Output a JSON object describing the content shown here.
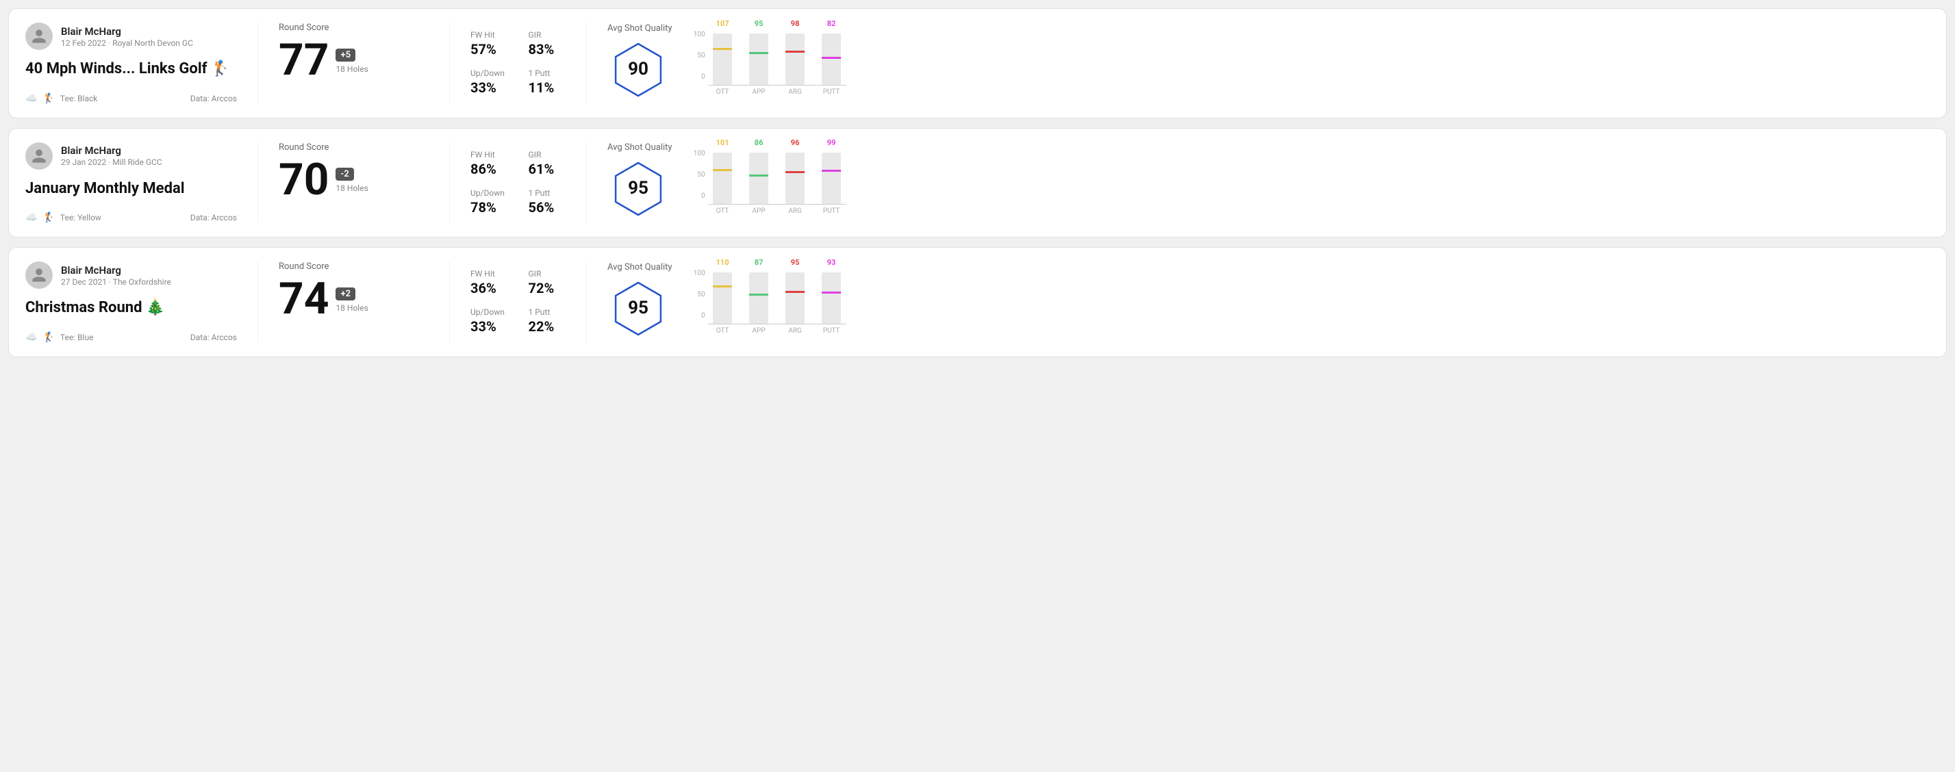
{
  "rounds": [
    {
      "id": "round-1",
      "user": {
        "name": "Blair McHarg",
        "date": "12 Feb 2022 · Royal North Devon GC"
      },
      "title": "40 Mph Winds... Links Golf 🏌️",
      "tee": "Black",
      "data_source": "Data: Arccos",
      "score": {
        "value": "77",
        "diff": "+5",
        "holes": "18 Holes"
      },
      "stats": {
        "fw_hit": "57%",
        "gir": "83%",
        "up_down": "33%",
        "one_putt": "11%"
      },
      "avg_quality": "90",
      "chart": {
        "bars": [
          {
            "label": "OTT",
            "value": 107,
            "color": "#e8c040",
            "height_pct": 72
          },
          {
            "label": "APP",
            "value": 95,
            "color": "#50c878",
            "height_pct": 64
          },
          {
            "label": "ARG",
            "value": 98,
            "color": "#e04040",
            "height_pct": 66
          },
          {
            "label": "PUTT",
            "value": 82,
            "color": "#e040e0",
            "height_pct": 55
          }
        ]
      }
    },
    {
      "id": "round-2",
      "user": {
        "name": "Blair McHarg",
        "date": "29 Jan 2022 · Mill Ride GCC"
      },
      "title": "January Monthly Medal",
      "tee": "Yellow",
      "data_source": "Data: Arccos",
      "score": {
        "value": "70",
        "diff": "-2",
        "holes": "18 Holes"
      },
      "stats": {
        "fw_hit": "86%",
        "gir": "61%",
        "up_down": "78%",
        "one_putt": "56%"
      },
      "avg_quality": "95",
      "chart": {
        "bars": [
          {
            "label": "OTT",
            "value": 101,
            "color": "#e8c040",
            "height_pct": 68
          },
          {
            "label": "APP",
            "value": 86,
            "color": "#50c878",
            "height_pct": 58
          },
          {
            "label": "ARG",
            "value": 96,
            "color": "#e04040",
            "height_pct": 65
          },
          {
            "label": "PUTT",
            "value": 99,
            "color": "#e040e0",
            "height_pct": 67
          }
        ]
      }
    },
    {
      "id": "round-3",
      "user": {
        "name": "Blair McHarg",
        "date": "27 Dec 2021 · The Oxfordshire"
      },
      "title": "Christmas Round 🎄",
      "tee": "Blue",
      "data_source": "Data: Arccos",
      "score": {
        "value": "74",
        "diff": "+2",
        "holes": "18 Holes"
      },
      "stats": {
        "fw_hit": "36%",
        "gir": "72%",
        "up_down": "33%",
        "one_putt": "22%"
      },
      "avg_quality": "95",
      "chart": {
        "bars": [
          {
            "label": "OTT",
            "value": 110,
            "color": "#e8c040",
            "height_pct": 74
          },
          {
            "label": "APP",
            "value": 87,
            "color": "#50c878",
            "height_pct": 59
          },
          {
            "label": "ARG",
            "value": 95,
            "color": "#e04040",
            "height_pct": 64
          },
          {
            "label": "PUTT",
            "value": 93,
            "color": "#e040e0",
            "height_pct": 63
          }
        ]
      }
    }
  ],
  "labels": {
    "round_score": "Round Score",
    "fw_hit": "FW Hit",
    "gir": "GIR",
    "up_down": "Up/Down",
    "one_putt": "1 Putt",
    "avg_quality": "Avg Shot Quality",
    "data_arccos": "Data: Arccos",
    "tee_prefix": "Tee:",
    "y_axis_100": "100",
    "y_axis_50": "50",
    "y_axis_0": "0"
  }
}
